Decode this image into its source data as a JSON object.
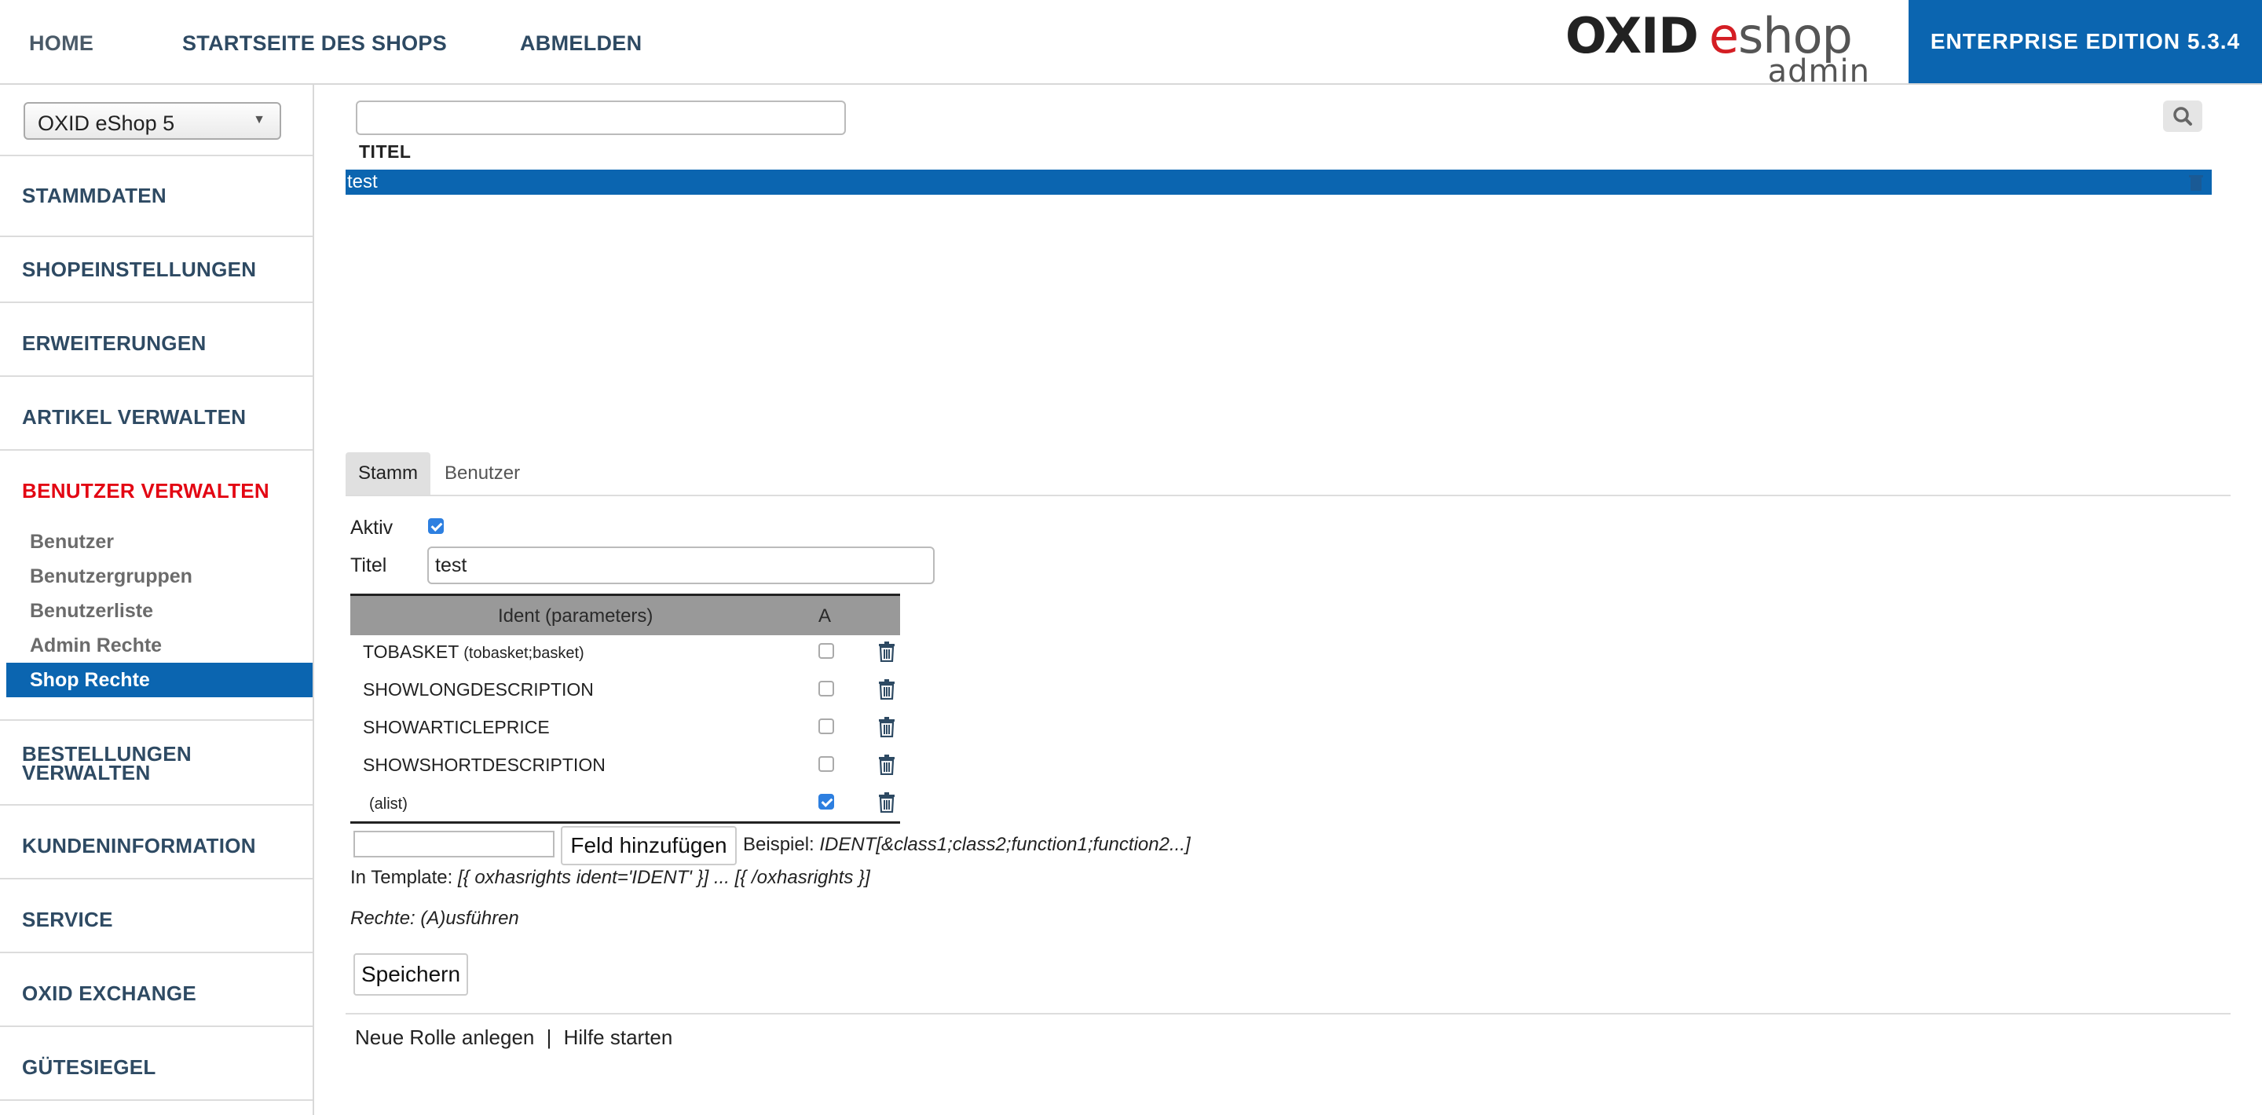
{
  "topnav": {
    "home": "HOME",
    "shop_start": "STARTSEITE DES SHOPS",
    "logout": "ABMELDEN"
  },
  "logo": {
    "oxid": "OXID",
    "e": "e",
    "shop": "shop",
    "admin": "admin"
  },
  "edition": "ENTERPRISE EDITION 5.3.4",
  "shop_select": {
    "value": "OXID eShop 5"
  },
  "sidebar": {
    "categories": [
      {
        "label": "STAMMDATEN"
      },
      {
        "label": "SHOPEINSTELLUNGEN"
      },
      {
        "label": "ERWEITERUNGEN"
      },
      {
        "label": "ARTIKEL VERWALTEN"
      },
      {
        "label": "BENUTZER VERWALTEN",
        "active": true
      },
      {
        "label": "BESTELLUNGEN",
        "label2": "VERWALTEN"
      },
      {
        "label": "KUNDENINFORMATION"
      },
      {
        "label": "SERVICE"
      },
      {
        "label": "OXID EXCHANGE"
      },
      {
        "label": "GÜTESIEGEL"
      }
    ],
    "sub_items": [
      {
        "label": "Benutzer"
      },
      {
        "label": "Benutzergruppen"
      },
      {
        "label": "Benutzerliste"
      },
      {
        "label": "Admin Rechte"
      },
      {
        "label": "Shop Rechte",
        "active": true
      }
    ]
  },
  "list": {
    "search_value": "",
    "column_title": "TITEL",
    "rows": [
      {
        "title": "test",
        "selected": true
      }
    ]
  },
  "tabs": [
    {
      "label": "Stamm",
      "active": true
    },
    {
      "label": "Benutzer"
    }
  ],
  "form": {
    "aktiv_label": "Aktiv",
    "aktiv_checked": true,
    "titel_label": "Titel",
    "titel_value": "test"
  },
  "rights_table": {
    "headers": {
      "ident": "Ident (parameters)",
      "a": "A"
    },
    "rows": [
      {
        "ident": "TOBASKET",
        "params": "(tobasket;basket)",
        "a": false
      },
      {
        "ident": "SHOWLONGDESCRIPTION",
        "params": "",
        "a": false
      },
      {
        "ident": "SHOWARTICLEPRICE",
        "params": "",
        "a": false
      },
      {
        "ident": "SHOWSHORTDESCRIPTION",
        "params": "",
        "a": false
      },
      {
        "ident": "",
        "params": "(alist)",
        "a": true
      }
    ]
  },
  "add_field": {
    "input_value": "",
    "button_label": "Feld hinzufügen",
    "example_prefix": "Beispiel: ",
    "example_code": "IDENT[&class1;class2;function1;function2...]"
  },
  "template_hint": {
    "prefix": "In Template: ",
    "code": "[{ oxhasrights ident='IDENT' }] ... [{ /oxhasrights }]"
  },
  "rights_legend": "Rechte: (A)usführen",
  "save_label": "Speichern",
  "bottom_links": {
    "new_role": "Neue Rolle anlegen",
    "separator": "|",
    "help": "Hilfe starten"
  },
  "colors": {
    "brand_blue": "#0b65b0",
    "active_red": "#e30613",
    "nav_text": "#2e4a63"
  }
}
